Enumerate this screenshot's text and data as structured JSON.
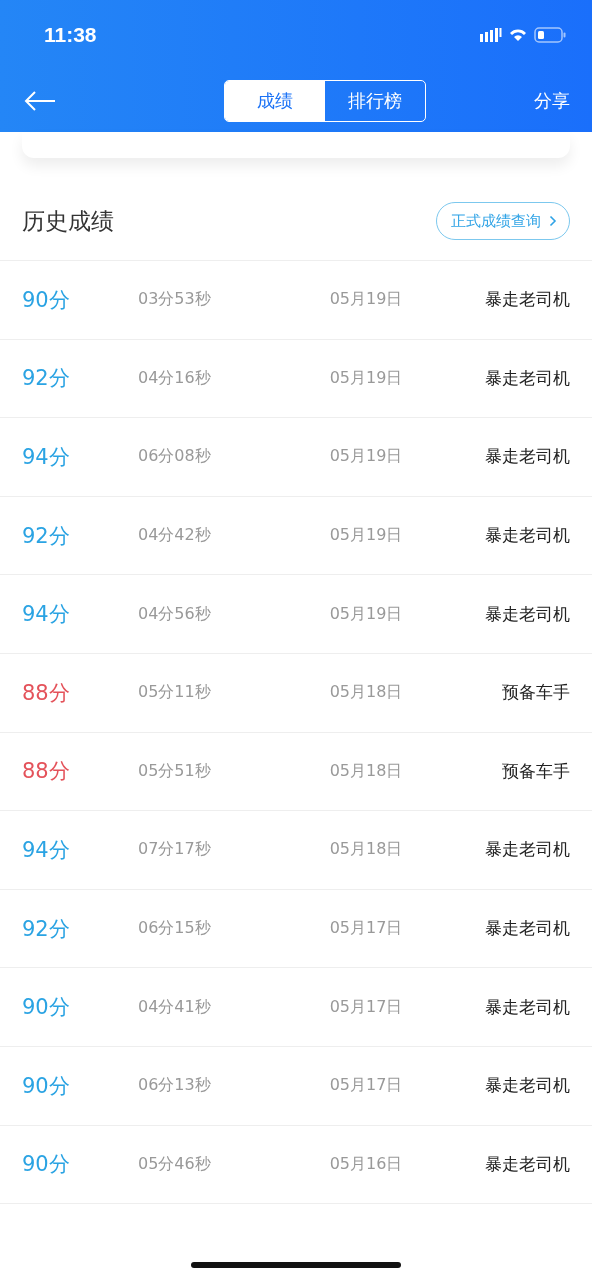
{
  "status_bar": {
    "time": "11:38"
  },
  "nav": {
    "tabs": [
      {
        "label": "成绩",
        "selected": true
      },
      {
        "label": "排行榜",
        "selected": false
      }
    ],
    "share": "分享"
  },
  "history": {
    "title": "历史成绩",
    "query_button": "正式成绩查询",
    "rows": [
      {
        "score": "90分",
        "passed": true,
        "duration": "03分53秒",
        "date": "05月19日",
        "rank": "暴走老司机"
      },
      {
        "score": "92分",
        "passed": true,
        "duration": "04分16秒",
        "date": "05月19日",
        "rank": "暴走老司机"
      },
      {
        "score": "94分",
        "passed": true,
        "duration": "06分08秒",
        "date": "05月19日",
        "rank": "暴走老司机"
      },
      {
        "score": "92分",
        "passed": true,
        "duration": "04分42秒",
        "date": "05月19日",
        "rank": "暴走老司机"
      },
      {
        "score": "94分",
        "passed": true,
        "duration": "04分56秒",
        "date": "05月19日",
        "rank": "暴走老司机"
      },
      {
        "score": "88分",
        "passed": false,
        "duration": "05分11秒",
        "date": "05月18日",
        "rank": "预备车手"
      },
      {
        "score": "88分",
        "passed": false,
        "duration": "05分51秒",
        "date": "05月18日",
        "rank": "预备车手"
      },
      {
        "score": "94分",
        "passed": true,
        "duration": "07分17秒",
        "date": "05月18日",
        "rank": "暴走老司机"
      },
      {
        "score": "92分",
        "passed": true,
        "duration": "06分15秒",
        "date": "05月17日",
        "rank": "暴走老司机"
      },
      {
        "score": "90分",
        "passed": true,
        "duration": "04分41秒",
        "date": "05月17日",
        "rank": "暴走老司机"
      },
      {
        "score": "90分",
        "passed": true,
        "duration": "06分13秒",
        "date": "05月17日",
        "rank": "暴走老司机"
      },
      {
        "score": "90分",
        "passed": true,
        "duration": "05分46秒",
        "date": "05月16日",
        "rank": "暴走老司机"
      }
    ]
  }
}
